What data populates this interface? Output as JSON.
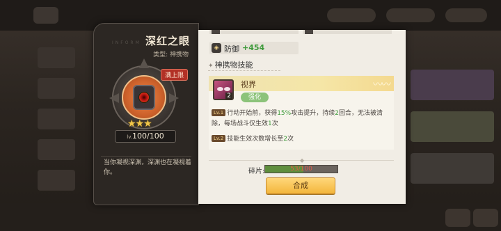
{
  "item": {
    "name": "深红之眼",
    "deco_text": "INFORM",
    "type_label": "类型: 神携物",
    "max_badge": "满上限",
    "stars": "★★★",
    "level_prefix": "lv.",
    "level_value": "100/100",
    "flavor_text": "当你凝视深渊，深渊也在凝视着你。",
    "gem_icon": "crimson-eye-icon"
  },
  "stats": {
    "defense_label": "防御",
    "defense_value": "+454",
    "defense_icon": "shield-icon"
  },
  "skill_section": {
    "title": "神携物技能",
    "skill_name": "视界",
    "skill_count": "2",
    "enhance_label": "强化",
    "lv1_tag": "Lv.1",
    "lv1_text_a": "行动开始前，获得",
    "lv1_highlight_a": "15%",
    "lv1_text_b": "攻击提升，持续",
    "lv1_highlight_b": "2",
    "lv1_text_c": "回合，无法被清除，每场战斗仅生效",
    "lv1_highlight_c": "1",
    "lv1_text_d": "次",
    "lv2_tag": "Lv.2",
    "lv2_text_a": "技能生效次数增长至",
    "lv2_highlight": "2",
    "lv2_text_b": "次"
  },
  "fragments": {
    "label": "碎片:",
    "text": "53/100",
    "progress": 0.53
  },
  "compose_button": "合成",
  "colors": {
    "accent_gold": "#f3b63c",
    "stat_green": "#3d9a3a",
    "badge_red": "#b23126",
    "parchment": "#f1ede5"
  }
}
